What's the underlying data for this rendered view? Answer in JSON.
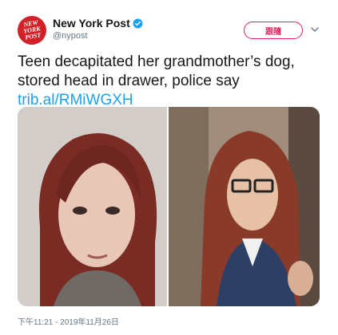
{
  "account": {
    "name": "New York Post",
    "handle": "@nypost",
    "avatar_text": [
      "NEW",
      "YORK",
      "POST"
    ],
    "brand_color": "#d31f26",
    "verified_icon": "verified-badge-icon"
  },
  "follow_label": "跟隨",
  "tweet": {
    "text_line1": "Teen decapitated her grandmother’s dog,",
    "text_line2": "stored head in drawer, police say",
    "link": "trib.al/RMiWGXH"
  },
  "timestamp": "下午11:21 - 2019年11月26日",
  "colors": {
    "accent": "#1da1f2",
    "follow": "#e0245e",
    "muted": "#657786"
  }
}
